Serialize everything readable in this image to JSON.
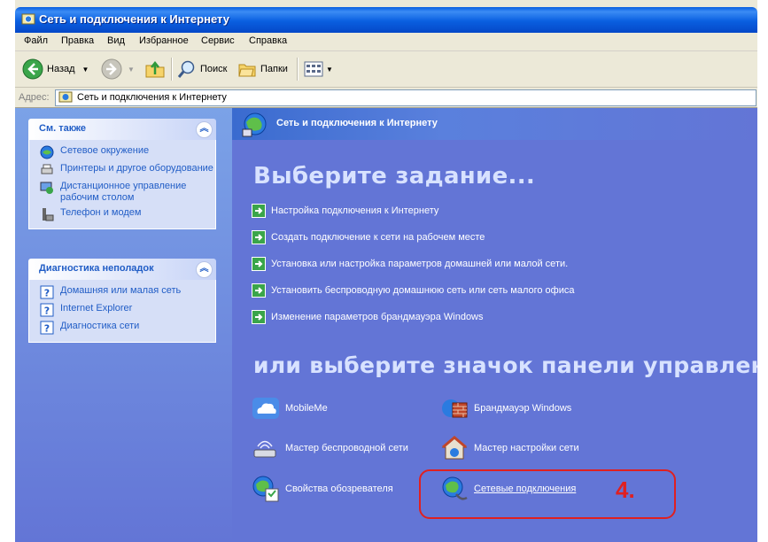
{
  "window": {
    "title": "Сеть и подключения к Интернету"
  },
  "menu": [
    "Файл",
    "Правка",
    "Вид",
    "Избранное",
    "Сервис",
    "Справка"
  ],
  "toolbar": {
    "back_label": "Назад",
    "search_label": "Поиск",
    "folders_label": "Папки"
  },
  "address": {
    "label": "Адрес:",
    "value": "Сеть и подключения к Интернету"
  },
  "see_also": {
    "title": "См. также",
    "items": [
      "Сетевое окружение",
      "Принтеры и другое оборудование",
      "Дистанционное управление рабочим столом",
      "Телефон и модем"
    ]
  },
  "troubleshoot": {
    "title": "Диагностика неполадок",
    "items": [
      "Домашняя или малая сеть",
      "Internet Explorer",
      "Диагностика сети"
    ]
  },
  "content": {
    "header": "Сеть и подключения к Интернету",
    "pick_task": "Выберите задание...",
    "tasks": [
      "Настройка подключения к Интернету",
      "Создать подключение к сети на рабочем месте",
      "Установка или настройка параметров домашней или малой сети.",
      "Установить беспроводную домашнюю сеть или сеть малого офиса",
      "Изменение параметров брандмауэра Windows"
    ],
    "pick_icon": "или выберите значок панели управления",
    "icons": [
      "MobileMe",
      "Брандмауэр Windows",
      "Мастер беспроводной сети",
      "Мастер настройки сети",
      "Свойства обозревателя",
      "Сетевые подключения"
    ]
  },
  "annotation": {
    "number": "4."
  }
}
